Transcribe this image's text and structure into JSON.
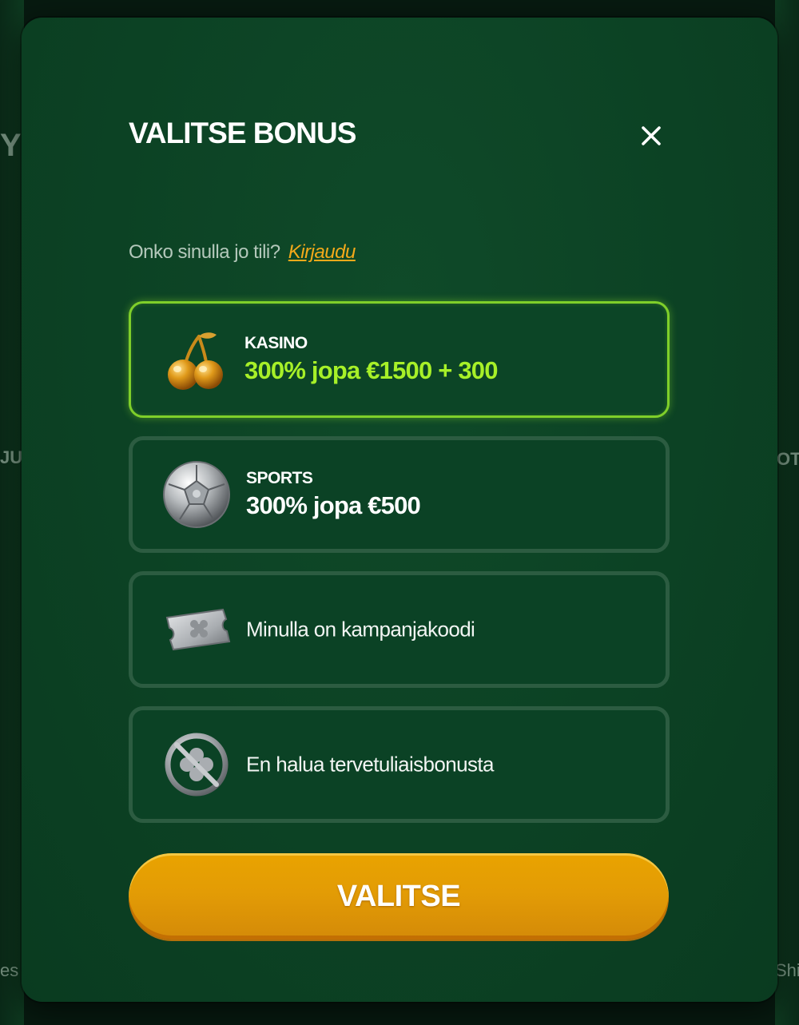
{
  "modal": {
    "title": "VALITSE BONUS",
    "close_icon": "close-icon",
    "login_prompt": "Onko sinulla jo tili?",
    "login_link": "Kirjaudu"
  },
  "options": [
    {
      "icon": "cherry-icon",
      "label": "KASINO",
      "offer": "300% jopa €1500 + 300",
      "selected": true
    },
    {
      "icon": "soccer-ball-icon",
      "label": "SPORTS",
      "offer": "300% jopa €500",
      "selected": false
    },
    {
      "icon": "ticket-icon",
      "text": "Minulla on kampanjakoodi",
      "selected": false
    },
    {
      "icon": "no-bonus-icon",
      "text": "En halua tervetuliaisbonusta",
      "selected": false
    }
  ],
  "cta": {
    "label": "VALITSE"
  },
  "background_edges": {
    "left_1": "Y",
    "left_2": "JU",
    "left_3": "es",
    "right_1": "OT",
    "right_2": "Shi"
  },
  "colors": {
    "modal_bg": "#0c4224",
    "selected_border": "#7fcf2a",
    "offer_green": "#a7f028",
    "link_orange": "#f3a91a",
    "cta_orange": "#e39c05"
  }
}
